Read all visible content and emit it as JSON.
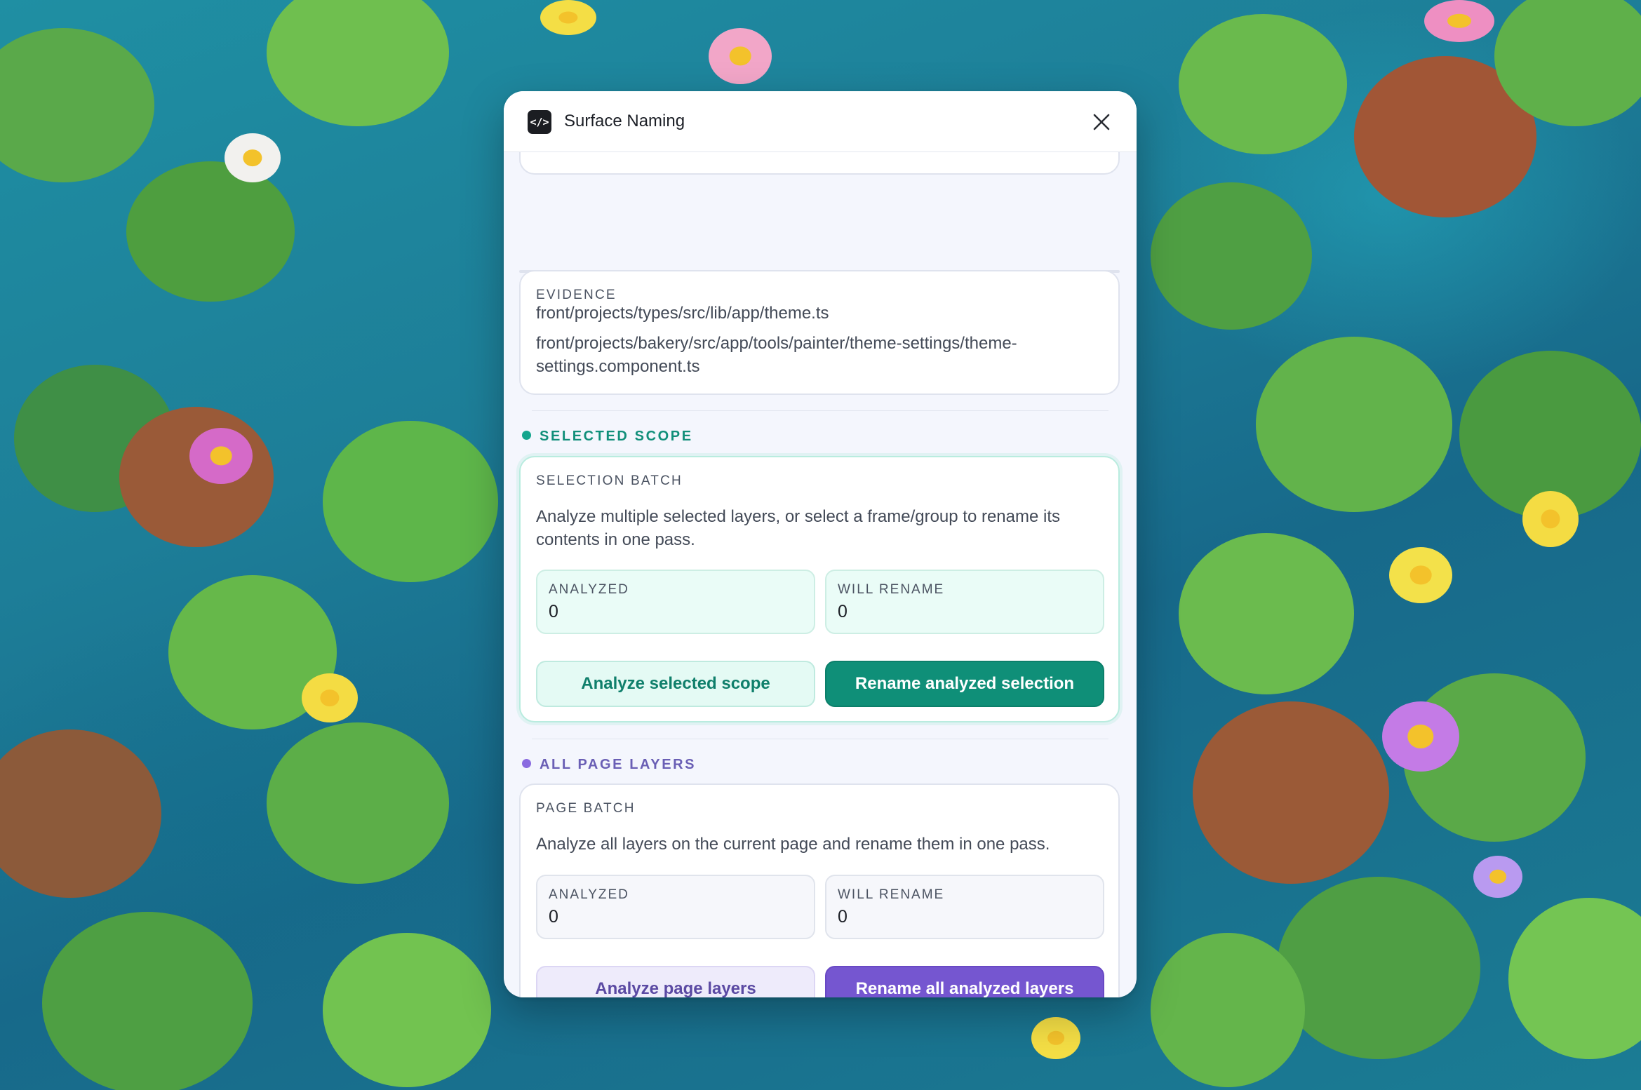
{
  "window": {
    "title": "Surface Naming",
    "icon": "code-brackets-icon",
    "icon_glyph": "</>",
    "close_icon": "close-icon"
  },
  "evidence": {
    "label": "EVIDENCE",
    "files": [
      "front/projects/types/src/lib/app/theme.ts",
      "front/projects/bakery/src/app/tools/painter/theme-settings/theme-settings.component.ts"
    ]
  },
  "selected_scope": {
    "section_label": "SELECTED SCOPE",
    "accent_color": "#12a08a",
    "card_label": "SELECTION BATCH",
    "description": "Analyze multiple selected layers, or select a frame/group to rename its contents in one pass.",
    "stats": {
      "analyzed_label": "ANALYZED",
      "analyzed_value": "0",
      "will_rename_label": "WILL RENAME",
      "will_rename_value": "0"
    },
    "analyze_button": "Analyze selected scope",
    "rename_button": "Rename analyzed selection"
  },
  "all_page_layers": {
    "section_label": "ALL PAGE LAYERS",
    "accent_color": "#7e62d6",
    "card_label": "PAGE BATCH",
    "description": "Analyze all layers on the current page and rename them in one pass.",
    "stats": {
      "analyzed_label": "ANALYZED",
      "analyzed_value": "0",
      "will_rename_label": "WILL RENAME",
      "will_rename_value": "0"
    },
    "analyze_button": "Analyze page layers",
    "rename_button": "Rename all analyzed layers"
  },
  "colors": {
    "teal_primary": "#0f8f78",
    "teal_soft": "#e8fbf6",
    "purple_primary": "#7556d0",
    "purple_soft": "#efecfc",
    "panel_background": "#f4f6fd"
  }
}
